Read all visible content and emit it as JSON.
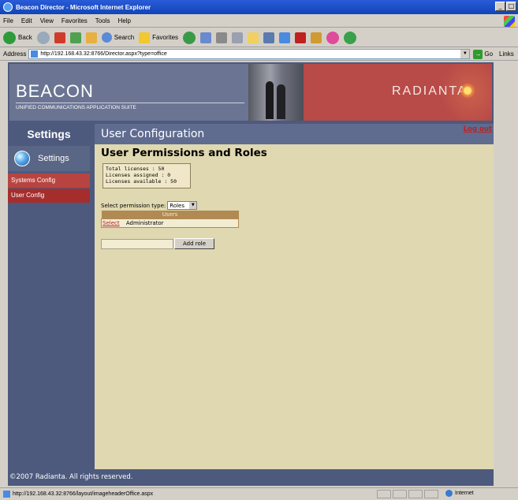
{
  "window": {
    "title": "Beacon Director - Microsoft Internet Explorer",
    "controls": [
      "_",
      "□"
    ]
  },
  "menubar": [
    "File",
    "Edit",
    "View",
    "Favorites",
    "Tools",
    "Help"
  ],
  "toolbar": {
    "back": "Back",
    "search": "Search",
    "favorites": "Favorites"
  },
  "address": {
    "label": "Address",
    "url": "http://192.168.43.32:8766/Director.aspx?type=office",
    "go": "Go",
    "links": "Links"
  },
  "banner": {
    "brand": "BEACON",
    "tagline": "UNIFIED COMMUNICATIONS APPLICATION SUITE",
    "partner": "RADIANTA"
  },
  "header": {
    "settings_title": "Settings",
    "page_heading": "User Configuration",
    "logout": "Log out"
  },
  "sidebar": {
    "settings_label": "Settings",
    "items": [
      {
        "label": "Systems Config"
      },
      {
        "label": "User Config"
      }
    ]
  },
  "main": {
    "title": "User Permissions and Roles",
    "licenses": {
      "total": "Total licenses : 50",
      "assigned": "Licenses assigned : 0",
      "available": "Licenses available : 50"
    },
    "permission_label": "Select permission type:",
    "permission_value": "Roles",
    "table": {
      "header": "Users",
      "rows": [
        {
          "action": "Select",
          "name": "Administrator"
        }
      ]
    },
    "add_role_button": "Add role"
  },
  "footer": {
    "copyright": "©2007 Radianta. All rights reserved."
  },
  "status": {
    "url": "http://192.168.43.32:8766/layout/imageheaderOffice.aspx",
    "zone": "Internet"
  }
}
